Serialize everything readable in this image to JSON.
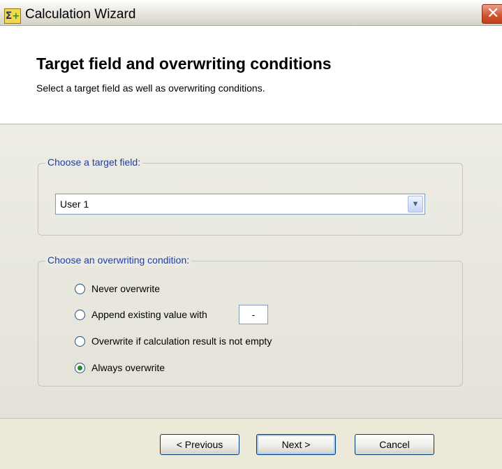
{
  "window": {
    "title": "Calculation Wizard",
    "icon": "sigma-plus-icon",
    "close_glyph": "✕"
  },
  "header": {
    "title": "Target field and overwriting conditions",
    "subtitle": "Select a target field as well as overwriting conditions."
  },
  "target_field": {
    "legend": "Choose a target field:",
    "selected": "User 1"
  },
  "overwrite": {
    "legend": "Choose an overwriting condition:",
    "options": [
      {
        "label": "Never overwrite",
        "checked": false
      },
      {
        "label": "Append existing value with",
        "checked": false
      },
      {
        "label": "Overwrite if calculation result is not empty",
        "checked": false
      },
      {
        "label": "Always overwrite",
        "checked": true
      }
    ],
    "append_value": "-"
  },
  "buttons": {
    "previous": "< Previous",
    "next": "Next >",
    "cancel": "Cancel"
  },
  "colors": {
    "legend_text": "#1f3ea3",
    "dialog_bg": "#ece9d8",
    "close_button": "#d2502e"
  }
}
